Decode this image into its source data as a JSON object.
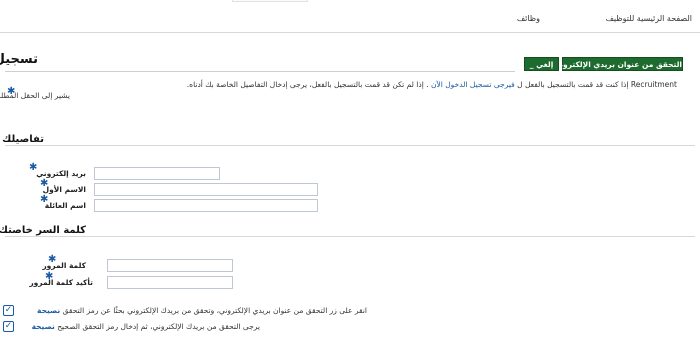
{
  "nav": {
    "home_tab": "الصفحة الرئيسية للتوظيف",
    "jobs_tab": "وظائف"
  },
  "page": {
    "title": "تسجيل",
    "verify_button": "التحقق من عنوان بريدي الإلكتروني",
    "cancel_button": "إلغي _",
    "intro_before_link": "Recruitment إذا كنت قد قمت بالتسجيل بالفعل ل",
    "intro_after_link": ". إذا لم تكن قد قمت بالتسجيل بالفعل، يرجى إدخال التفاصيل الخاصة بك أدناه.",
    "intro_link": "فيرجى تسجيل الدخول الآن",
    "required_note": "يشير إلى الحقل المطلوب"
  },
  "details": {
    "section_title": "تفاصيلك",
    "email_label": "بريد إلكتروني",
    "first_name_label": "الاسم الأول",
    "last_name_label": "اسم العائلة"
  },
  "password": {
    "section_title": "كلمة السر خاصتك",
    "password_label": "كلمة المرور",
    "confirm_label": "تأكيد كلمة المرور"
  },
  "hints": {
    "hint1_text": "انقر على زر التحقق من عنوان بريدي الإلكتروني، وتحقق من بريدك الإلكتروني بحثًا عن رمز التحقق",
    "hint1_tip": "نصيحة",
    "hint2_text": "يرجى التحقق من بريدك الإلكتروني، ثم إدخال رمز التحقق الصحيح",
    "hint2_tip": "نصيحة"
  },
  "colors": {
    "button_green": "#1e6b2f",
    "link_blue": "#1a5aa6"
  },
  "icons": {
    "required": "asterisk-icon",
    "tip": "check-icon"
  }
}
